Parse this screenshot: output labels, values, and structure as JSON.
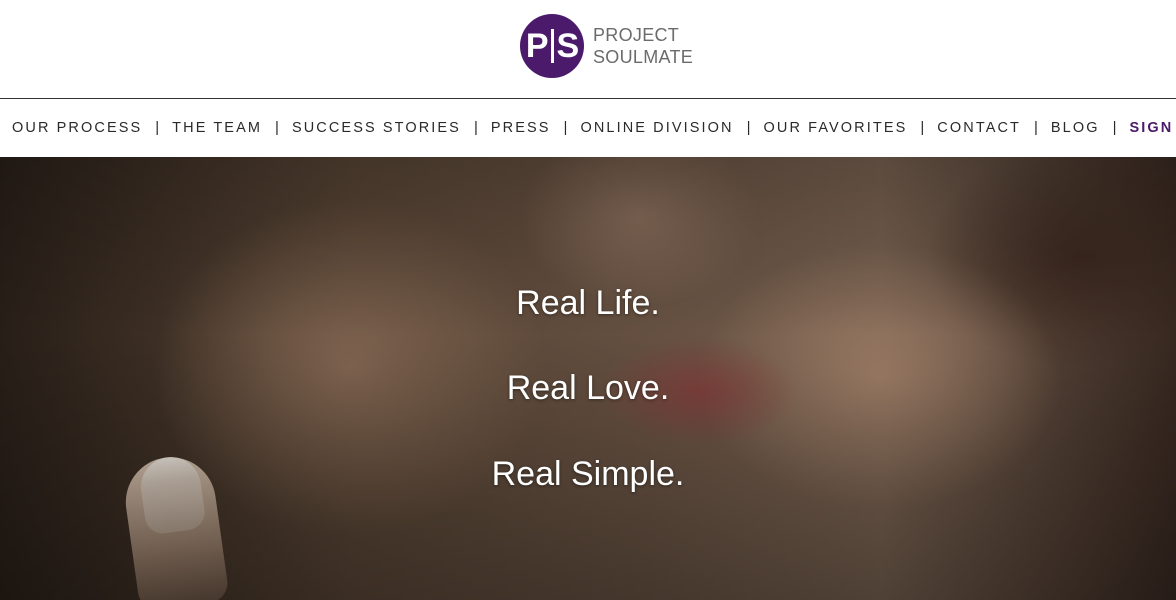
{
  "brand": {
    "logo_letters_left": "P",
    "logo_letters_right": "S",
    "name_line1": "PROJECT",
    "name_line2": "SOULMATE",
    "accent_color": "#4b1a6b"
  },
  "nav": {
    "items": [
      {
        "label": "OUR PROCESS"
      },
      {
        "label": "THE TEAM"
      },
      {
        "label": "SUCCESS STORIES"
      },
      {
        "label": "PRESS"
      },
      {
        "label": "ONLINE DIVISION"
      },
      {
        "label": "OUR FAVORITES"
      },
      {
        "label": "CONTACT"
      },
      {
        "label": "BLOG"
      },
      {
        "label": "SIGN"
      }
    ],
    "separator": "|"
  },
  "hero": {
    "line1": "Real Life.",
    "line2": "Real Love.",
    "line3": "Real Simple."
  }
}
